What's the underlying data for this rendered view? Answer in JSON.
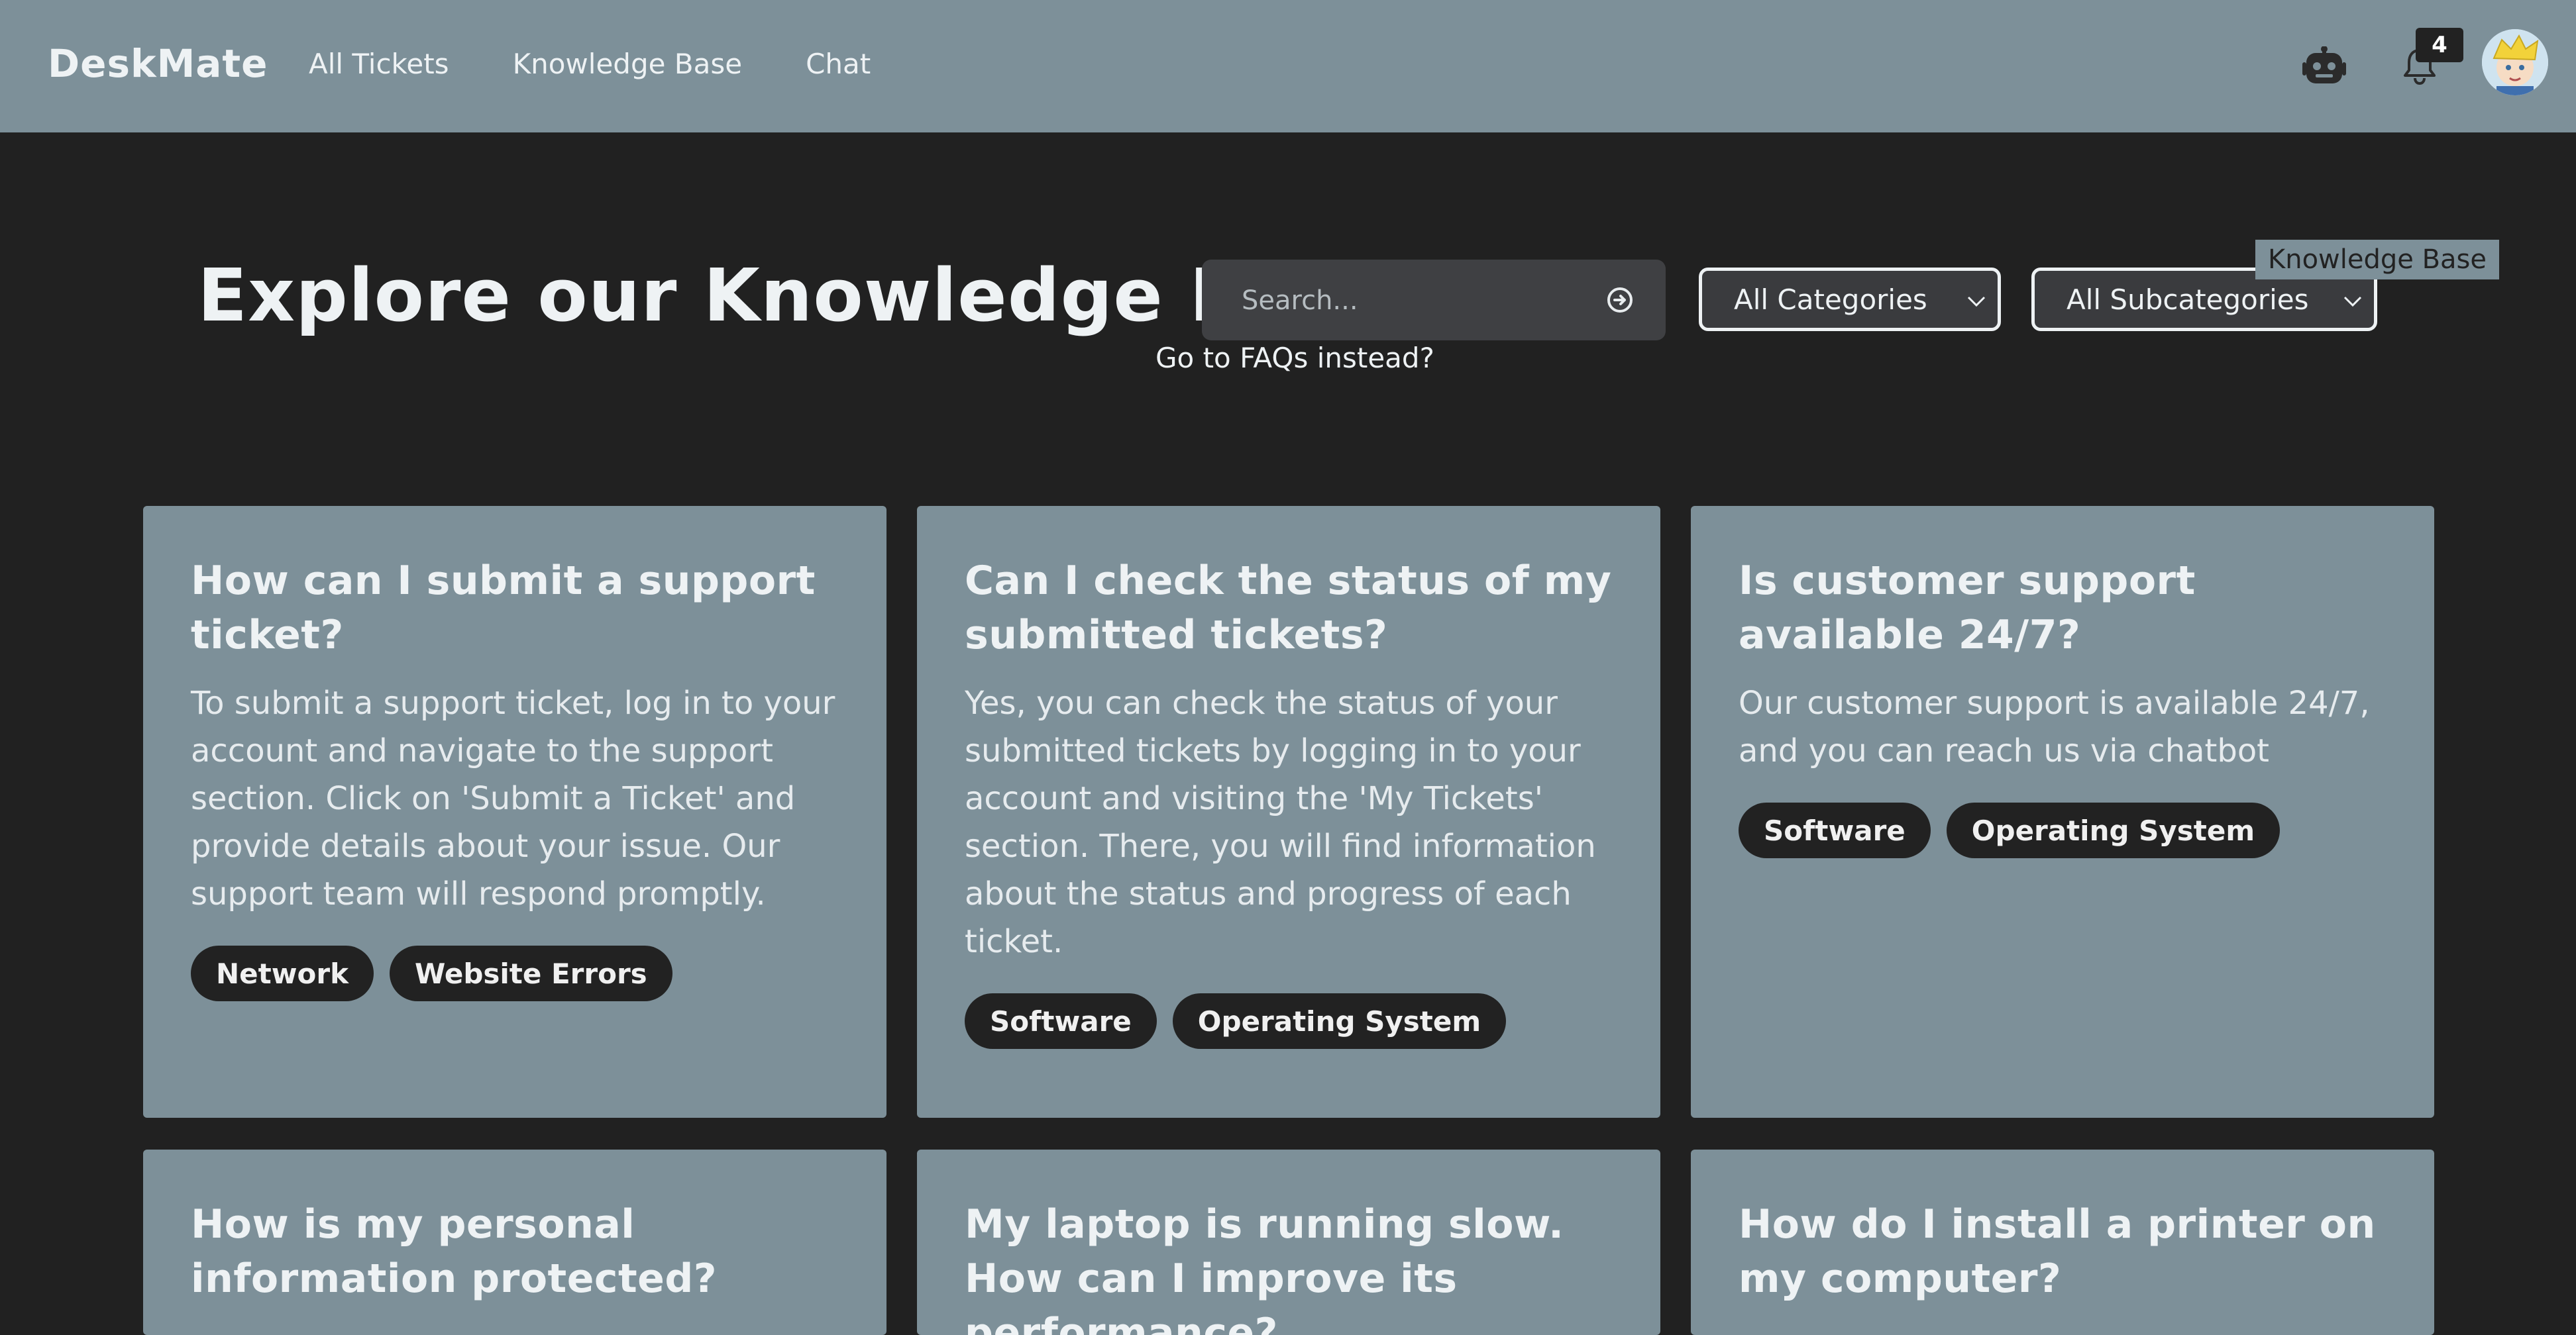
{
  "app": {
    "brand": "DeskMate"
  },
  "nav": {
    "links": [
      "All Tickets",
      "Knowledge Base",
      "Chat"
    ],
    "notification_count": "4",
    "icons": [
      "robot-icon",
      "bell-icon",
      "avatar"
    ]
  },
  "hero": {
    "title": "Explore our Knowledge Base",
    "search_placeholder": "Search...",
    "category_selected": "All Categories",
    "subcategory_selected": "All Subcategories",
    "tooltip": "Knowledge Base",
    "faq_link": "Go to FAQs instead?"
  },
  "articles": [
    {
      "title": "How can I submit a support ticket?",
      "body": "To submit a support ticket, log in to your account and navigate to the support section. Click on 'Submit a Ticket' and provide details about your issue. Our support team will respond promptly.",
      "tags": [
        "Network",
        "Website Errors"
      ]
    },
    {
      "title": "Can I check the status of my submitted tickets?",
      "body": "Yes, you can check the status of your submitted tickets by logging in to your account and visiting the 'My Tickets' section. There, you will find information about the status and progress of each ticket.",
      "tags": [
        "Software",
        "Operating System"
      ]
    },
    {
      "title": "Is customer support available 24/7?",
      "body": "Our customer support is available 24/7, and you can reach us via chatbot",
      "tags": [
        "Software",
        "Operating System"
      ]
    },
    {
      "title": "How is my personal information protected?",
      "body": "",
      "tags": []
    },
    {
      "title": "My laptop is running slow. How can I improve its performance?",
      "body": "",
      "tags": []
    },
    {
      "title": "How do I install a printer on my computer?",
      "body": "",
      "tags": []
    }
  ],
  "colors": {
    "nav_bg": "#7d9099",
    "page_bg": "#212121",
    "card_bg": "#7d9099",
    "tag_bg": "#222222"
  }
}
